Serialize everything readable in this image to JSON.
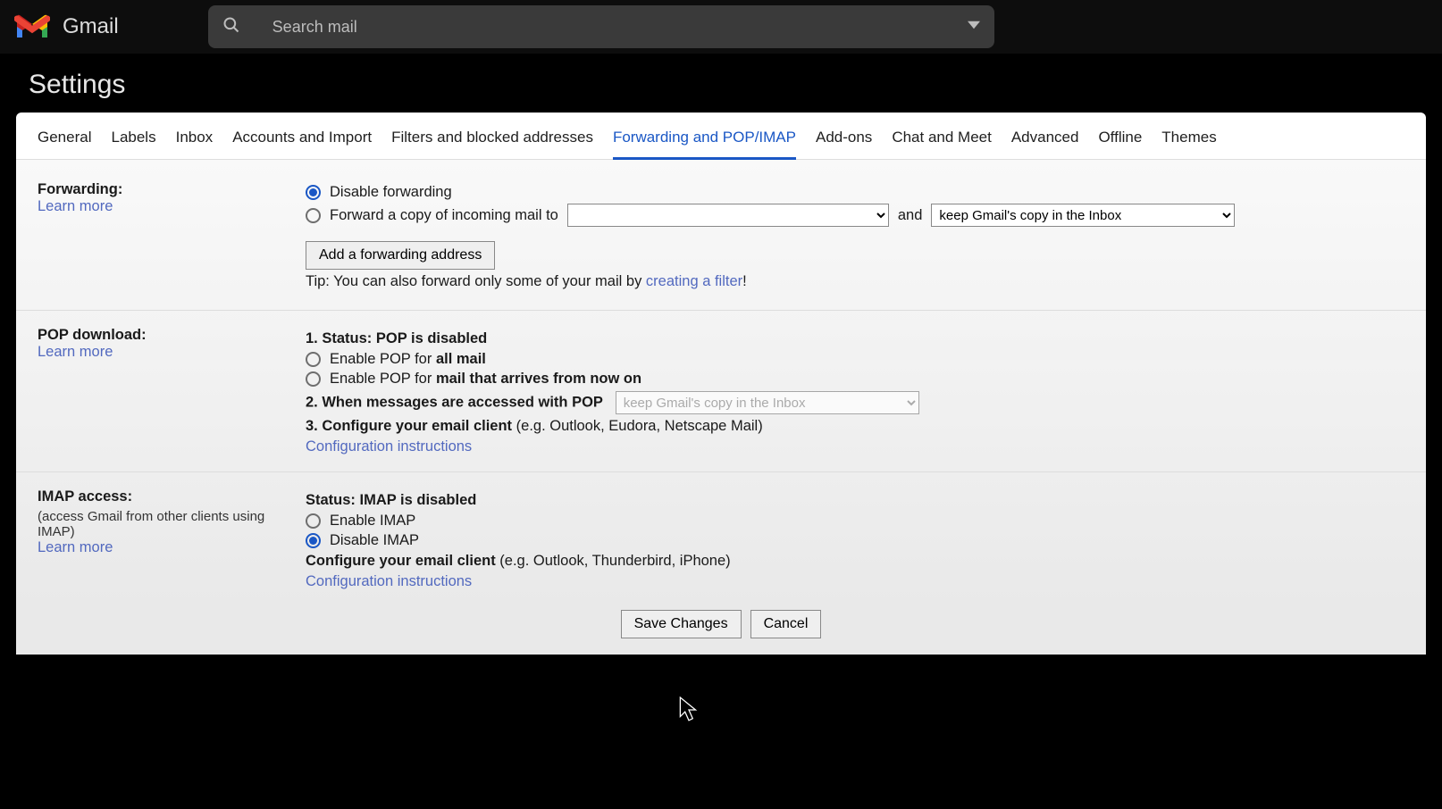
{
  "header": {
    "product": "Gmail",
    "search_placeholder": "Search mail"
  },
  "page_title": "Settings",
  "tabs": [
    "General",
    "Labels",
    "Inbox",
    "Accounts and Import",
    "Filters and blocked addresses",
    "Forwarding and POP/IMAP",
    "Add-ons",
    "Chat and Meet",
    "Advanced",
    "Offline",
    "Themes"
  ],
  "active_tab_index": 5,
  "forwarding": {
    "label": "Forwarding:",
    "learn_more": "Learn more",
    "disable_label": "Disable forwarding",
    "forward_copy_label": "Forward a copy of incoming mail to",
    "and_text": "and",
    "keep_option": "keep Gmail's copy in the Inbox",
    "add_button": "Add a forwarding address",
    "tip_prefix": "Tip: You can also forward only some of your mail by ",
    "tip_link": "creating a filter",
    "tip_suffix": "!"
  },
  "pop": {
    "label": "POP download:",
    "learn_more": "Learn more",
    "status_text": "1. Status: POP is disabled",
    "enable_all_prefix": "Enable POP for ",
    "enable_all_bold": "all mail",
    "enable_new_prefix": "Enable POP for ",
    "enable_new_bold": "mail that arrives from now on",
    "when_accessed": "2. When messages are accessed with POP",
    "keep_option": "keep Gmail's copy in the Inbox",
    "configure_bold": "3. Configure your email client",
    "configure_rest": " (e.g. Outlook, Eudora, Netscape Mail)",
    "config_link": "Configuration instructions"
  },
  "imap": {
    "label": "IMAP access:",
    "sub": "(access Gmail from other clients using IMAP)",
    "learn_more": "Learn more",
    "status_text": "Status: IMAP is disabled",
    "enable_label": "Enable IMAP",
    "disable_label": "Disable IMAP",
    "configure_bold": "Configure your email client",
    "configure_rest": " (e.g. Outlook, Thunderbird, iPhone)",
    "config_link": "Configuration instructions"
  },
  "actions": {
    "save": "Save Changes",
    "cancel": "Cancel"
  }
}
